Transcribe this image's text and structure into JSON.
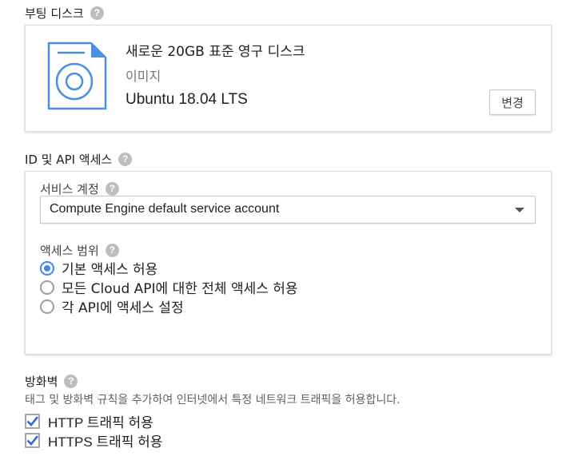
{
  "boot_disk": {
    "title": "부팅 디스크",
    "disk_name": "새로운 20GB 표준 영구 디스크",
    "image_label": "이미지",
    "image_value": "Ubuntu 18.04 LTS",
    "change_button": "변경"
  },
  "api_access": {
    "title": "ID 및 API 액세스",
    "service_account_label": "서비스 계정",
    "service_account_value": "Compute Engine default service account",
    "scope_label": "액세스 범위",
    "scopes": [
      {
        "label": "기본 액세스 허용",
        "checked": true
      },
      {
        "label": "모든 Cloud API에 대한 전체 액세스 허용",
        "checked": false
      },
      {
        "label": "각 API에 액세스 설정",
        "checked": false
      }
    ]
  },
  "firewall": {
    "title": "방화벽",
    "description": "태그 및 방화벽 규칙을 추가하여 인터넷에서 특정 네트워크 트래픽을 허용합니다.",
    "options": [
      {
        "label": "HTTP 트래픽 허용",
        "checked": true
      },
      {
        "label": "HTTPS 트래픽 허용",
        "checked": true
      }
    ]
  },
  "help_glyph": "?",
  "colors": {
    "accent": "#4285f4",
    "checkbox": "#3367d6",
    "icon_blue": "#4a90e2"
  }
}
